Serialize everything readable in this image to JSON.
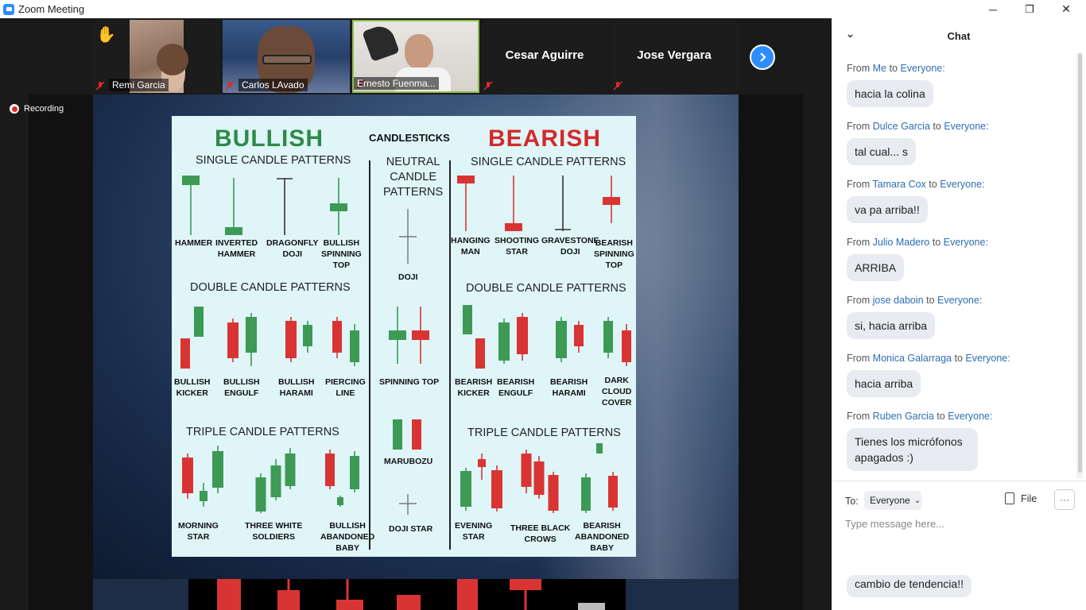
{
  "window": {
    "title": "Zoom Meeting",
    "minimize": "─",
    "restore": "❐",
    "close": "✕"
  },
  "gallery": {
    "participants": [
      {
        "name": "Remi Garcia",
        "muted": true,
        "raised_hand": true
      },
      {
        "name": "Carlos LAvado",
        "muted": true
      },
      {
        "name": "Ernesto Fuenma...",
        "muted": true,
        "active_speaker": true
      },
      {
        "name": "Cesar Aguirre",
        "muted": true,
        "video": false
      },
      {
        "name": "Jose Vergara",
        "muted": true,
        "video": false
      }
    ],
    "next_icon": "chevron-right-icon",
    "raised_hand_glyph": "✋"
  },
  "recording": {
    "label": "Recording"
  },
  "share": {
    "infographic": {
      "bullish": "BULLISH",
      "candlesticks": "CANDLESTICKS",
      "bearish": "BEARISH",
      "neutral": "NEUTRAL\nCANDLE\nPATTERNS",
      "bull_single": "SINGLE CANDLE PATTERNS",
      "bull_double": "DOUBLE CANDLE PATTERNS",
      "bull_triple": "TRIPLE CANDLE PATTERNS",
      "bear_single": "SINGLE CANDLE PATTERNS",
      "bear_double": "DOUBLE CANDLE PATTERNS",
      "bear_triple": "TRIPLE CANDLE PATTERNS",
      "labels": {
        "hammer": "HAMMER",
        "inverted_hammer": "INVERTED\nHAMMER",
        "dragonfly_doji": "DRAGONFLY\nDOJI",
        "bullish_spinning_top": "BULLISH\nSPINNING\nTOP",
        "bullish_kicker": "BULLISH\nKICKER",
        "bullish_engulf": "BULLISH\nENGULF",
        "bullish_harami": "BULLISH\nHARAMI",
        "piercing_line": "PIERCING\nLINE",
        "morning_star": "MORNING\nSTAR",
        "three_white_soldiers": "THREE WHITE\nSOLDIERS",
        "bullish_abandoned_baby": "BULLISH\nABANDONED\nBABY",
        "doji": "DOJI",
        "spinning_top": "SPINNING TOP",
        "marubozu": "MARUBOZU",
        "doji_star": "DOJI STAR",
        "hanging_man": "HANGING\nMAN",
        "shooting_star": "SHOOTING\nSTAR",
        "gravestone_doji": "GRAVESTONE\nDOJI",
        "bearish_spinning_top": "BEARISH\nSPINNING\nTOP",
        "bearish_kicker": "BEARISH\nKICKER",
        "bearish_engulf": "BEARISH\nENGULF",
        "bearish_harami": "BEARISH\nHARAMI",
        "dark_cloud_cover": "DARK\nCLOUD\nCOVER",
        "evening_star": "EVENING\nSTAR",
        "three_black_crows": "THREE BLACK\nCROWS",
        "bearish_abandoned_baby": "BEARISH\nABANDONED\nBABY"
      },
      "colors": {
        "bull": "#3c9a55",
        "bear": "#d93434",
        "bg": "#dff5f8"
      }
    }
  },
  "chat": {
    "title": "Chat",
    "messages": [
      {
        "prefix": "From",
        "sender": "Me",
        "to_word": "to",
        "recipient": "Everyone:",
        "text": "hacia la colina"
      },
      {
        "prefix": "From",
        "sender": "Dulce Garcia",
        "to_word": "to",
        "recipient": "Everyone:",
        "text": "tal cual... s"
      },
      {
        "prefix": "From",
        "sender": "Tamara Cox",
        "to_word": "to",
        "recipient": "Everyone:",
        "text": "va pa arriba!!"
      },
      {
        "prefix": "From",
        "sender": "Julio Madero",
        "to_word": "to",
        "recipient": "Everyone:",
        "text": "ARRIBA"
      },
      {
        "prefix": "From",
        "sender": "jose daboin",
        "to_word": "to",
        "recipient": "Everyone:",
        "text": "si, hacia arriba"
      },
      {
        "prefix": "From",
        "sender": "Monica Galarraga",
        "to_word": "to",
        "recipient": "Everyone:",
        "text": "hacia arriba"
      },
      {
        "prefix": "From",
        "sender": "Ruben Garcia",
        "to_word": "to",
        "recipient": "Everyone:",
        "text": "Tienes los micrófonos apagados :)"
      }
    ],
    "to_label": "To:",
    "to_value": "Everyone",
    "file_label": "File",
    "more_label": "···",
    "input_placeholder": "Type message here...",
    "draft_overlay": "cambio de tendencia!!"
  }
}
